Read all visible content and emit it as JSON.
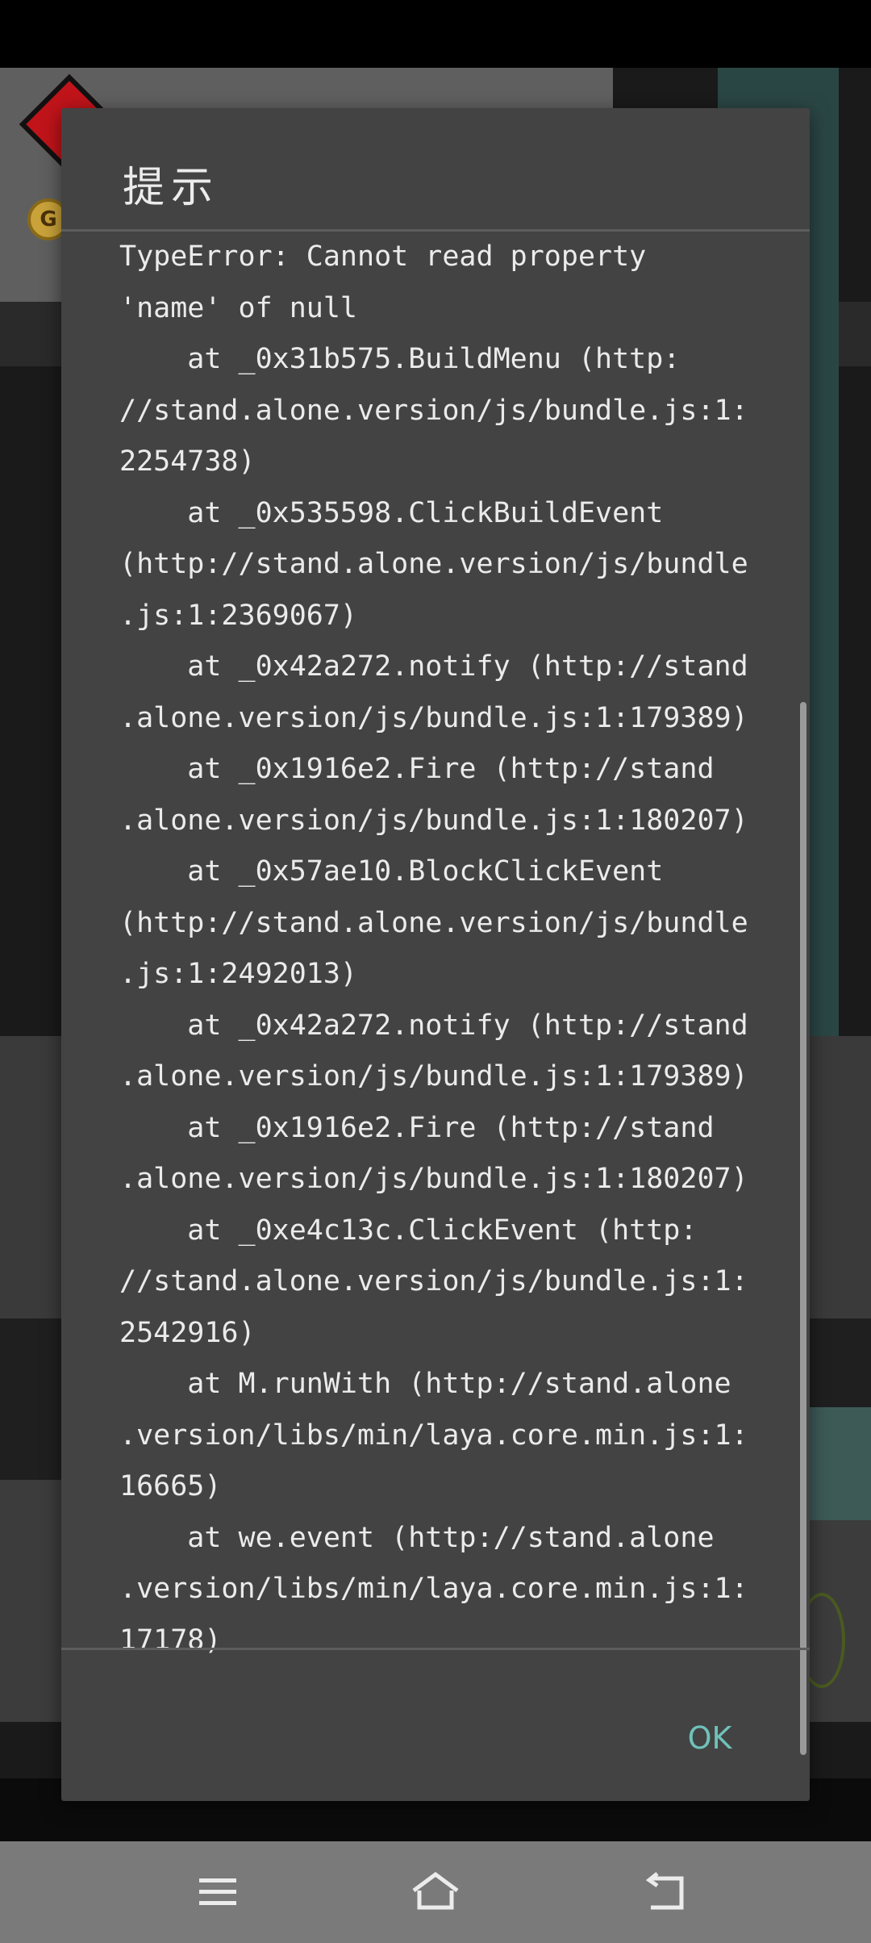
{
  "dialog": {
    "title": "提示",
    "message": "TypeError: Cannot read property\n'name' of null\n    at _0x31b575.BuildMenu (http:\n//stand.alone.version/js/bundle.js:1:\n2254738)\n    at _0x535598.ClickBuildEvent\n(http://stand.alone.version/js/bundle\n.js:1:2369067)\n    at _0x42a272.notify (http://stand\n.alone.version/js/bundle.js:1:179389)\n    at _0x1916e2.Fire (http://stand\n.alone.version/js/bundle.js:1:180207)\n    at _0x57ae10.BlockClickEvent\n(http://stand.alone.version/js/bundle\n.js:1:2492013)\n    at _0x42a272.notify (http://stand\n.alone.version/js/bundle.js:1:179389)\n    at _0x1916e2.Fire (http://stand\n.alone.version/js/bundle.js:1:180207)\n    at _0xe4c13c.ClickEvent (http:\n//stand.alone.version/js/bundle.js:1:\n2542916)\n    at M.runWith (http://stand.alone\n.version/libs/min/laya.core.min.js:1:\n16665)\n    at we.event (http://stand.alone\n.version/libs/min/laya.core.min.js:1:\n17178)",
    "ok_label": "OK"
  },
  "background": {
    "coin_letter": "G"
  },
  "nav_bar": {
    "icons": [
      "menu-icon",
      "home-icon",
      "back-icon"
    ]
  },
  "colors": {
    "dialog_bg": "#434343",
    "accent": "#6fc2b9",
    "nav_bar_bg": "#7a7a7a"
  }
}
